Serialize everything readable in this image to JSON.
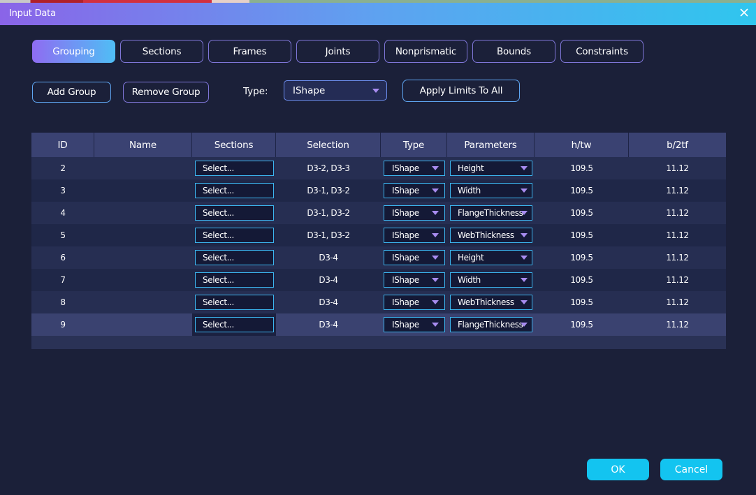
{
  "window": {
    "title": "Input Data",
    "close_icon": "close-icon"
  },
  "tabs": [
    {
      "label": "Grouping",
      "active": true
    },
    {
      "label": "Sections"
    },
    {
      "label": "Frames"
    },
    {
      "label": "Joints"
    },
    {
      "label": "Nonprismatic"
    },
    {
      "label": "Bounds"
    },
    {
      "label": "Constraints"
    }
  ],
  "toolbar": {
    "add_group": "Add Group",
    "remove_group": "Remove Group",
    "type_label": "Type:",
    "type_value": "IShape",
    "apply_limits": "Apply Limits To All"
  },
  "table": {
    "headers": [
      "ID",
      "Name",
      "Sections",
      "Selection",
      "Type",
      "Parameters",
      "h/tw",
      "b/2tf"
    ],
    "rows": [
      {
        "id": "2",
        "name": "",
        "sections": "Select...",
        "selection": "D3-2, D3-3",
        "type": "IShape",
        "parameter": "Height",
        "h_tw": "109.5",
        "b_2tf": "11.12"
      },
      {
        "id": "3",
        "name": "",
        "sections": "Select...",
        "selection": "D3-1, D3-2",
        "type": "IShape",
        "parameter": "Width",
        "h_tw": "109.5",
        "b_2tf": "11.12"
      },
      {
        "id": "4",
        "name": "",
        "sections": "Select...",
        "selection": "D3-1, D3-2",
        "type": "IShape",
        "parameter": "FlangeThickness",
        "h_tw": "109.5",
        "b_2tf": "11.12"
      },
      {
        "id": "5",
        "name": "",
        "sections": "Select...",
        "selection": "D3-1, D3-2",
        "type": "IShape",
        "parameter": "WebThickness",
        "h_tw": "109.5",
        "b_2tf": "11.12"
      },
      {
        "id": "6",
        "name": "",
        "sections": "Select...",
        "selection": "D3-4",
        "type": "IShape",
        "parameter": "Height",
        "h_tw": "109.5",
        "b_2tf": "11.12"
      },
      {
        "id": "7",
        "name": "",
        "sections": "Select...",
        "selection": "D3-4",
        "type": "IShape",
        "parameter": "Width",
        "h_tw": "109.5",
        "b_2tf": "11.12"
      },
      {
        "id": "8",
        "name": "",
        "sections": "Select...",
        "selection": "D3-4",
        "type": "IShape",
        "parameter": "WebThickness",
        "h_tw": "109.5",
        "b_2tf": "11.12"
      },
      {
        "id": "9",
        "name": "",
        "sections": "Select...",
        "selection": "D3-4",
        "type": "IShape",
        "parameter": "FlangeThickness",
        "h_tw": "109.5",
        "b_2tf": "11.12",
        "selected": true
      }
    ]
  },
  "footer": {
    "ok": "OK",
    "cancel": "Cancel"
  },
  "colors": {
    "accent": "#13c4f0",
    "background": "#1b2039",
    "header": "#3a4272"
  }
}
